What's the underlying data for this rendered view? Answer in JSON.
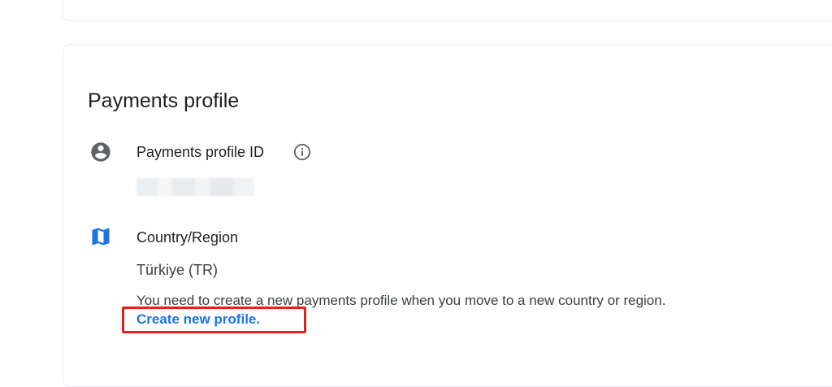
{
  "card": {
    "title": "Payments profile"
  },
  "profile_id": {
    "label": "Payments profile ID",
    "icon": "account-circle-icon",
    "info_icon": "info-icon",
    "value_redacted": true
  },
  "country": {
    "label": "Country/Region",
    "icon": "map-icon",
    "value": "Türkiye (TR)",
    "help_text": "You need to create a new payments profile when you move to a new country or region.",
    "link_label": "Create new profile."
  },
  "colors": {
    "link": "#1a73e8",
    "icon_gray": "#5f6368",
    "highlight": "#e8201a"
  }
}
